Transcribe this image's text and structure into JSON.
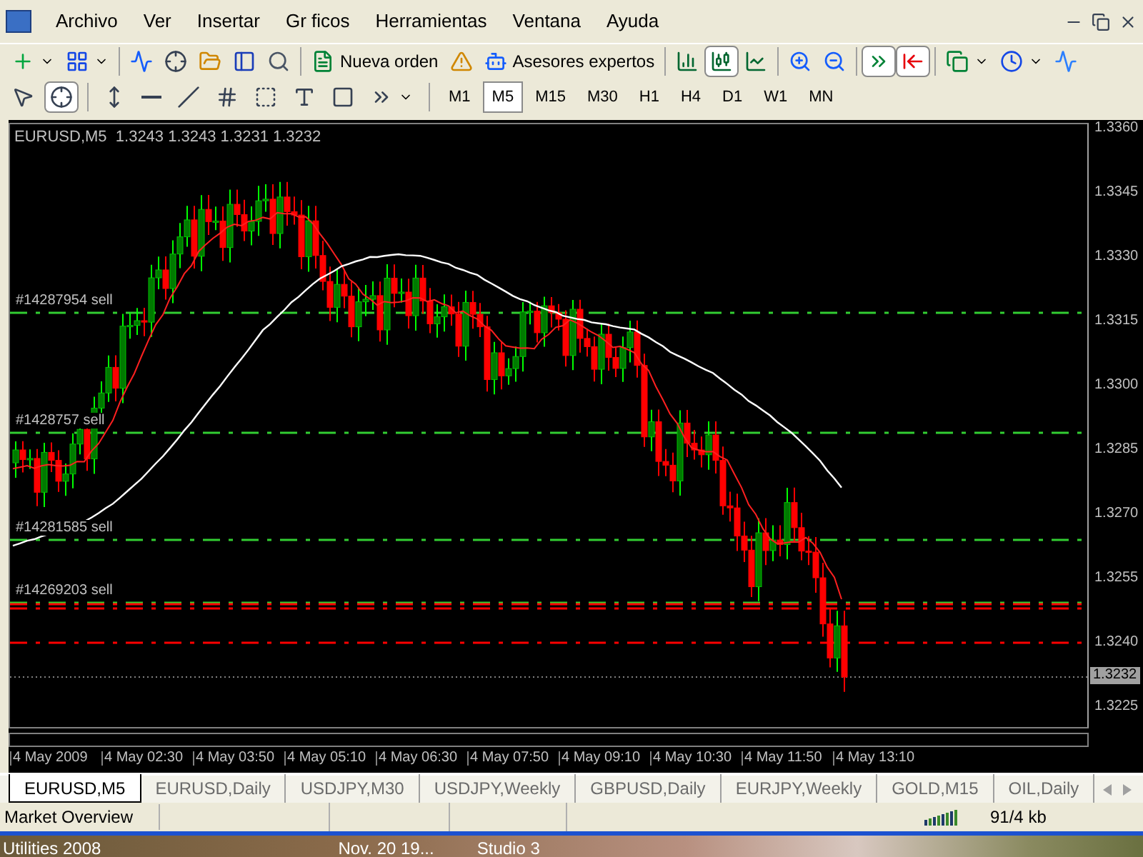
{
  "menu": {
    "items": [
      "Archivo",
      "Ver",
      "Insertar",
      "Gr ficos",
      "Herramientas",
      "Ventana",
      "Ayuda"
    ]
  },
  "toolbar_1": [
    {
      "kind": "dropdown",
      "pressed": false
    },
    {
      "kind": "dropdown",
      "pressed": false
    },
    {
      "kind": "separator"
    },
    {
      "kind": "icon",
      "pressed": false
    },
    {
      "kind": "icon",
      "pressed": false
    },
    {
      "kind": "icon",
      "pressed": false
    },
    {
      "kind": "icon",
      "pressed": false
    },
    {
      "kind": "icon",
      "pressed": false
    },
    {
      "kind": "separator"
    },
    {
      "kind": "labeled",
      "label": "Nueva orden",
      "pressed": false
    },
    {
      "kind": "icon",
      "pressed": false
    },
    {
      "kind": "labeled",
      "label": "Asesores expertos",
      "pressed": false
    },
    {
      "kind": "separator"
    },
    {
      "kind": "icon",
      "pressed": false
    },
    {
      "kind": "icon",
      "pressed": true
    },
    {
      "kind": "icon",
      "pressed": false
    },
    {
      "kind": "separator"
    },
    {
      "kind": "icon",
      "pressed": false
    },
    {
      "kind": "icon",
      "pressed": false
    },
    {
      "kind": "separator"
    },
    {
      "kind": "icon",
      "pressed": true
    },
    {
      "kind": "icon",
      "pressed": true
    },
    {
      "kind": "separator"
    },
    {
      "kind": "dropdown",
      "pressed": false
    },
    {
      "kind": "dropdown",
      "pressed": false
    },
    {
      "kind": "icon",
      "pressed": false
    }
  ],
  "toolbar_2": [
    {
      "kind": "icon",
      "pressed": false
    },
    {
      "kind": "icon",
      "pressed": true
    },
    {
      "kind": "separator"
    },
    {
      "kind": "icon",
      "pressed": false
    },
    {
      "kind": "icon",
      "pressed": false
    },
    {
      "kind": "icon",
      "pressed": false
    },
    {
      "kind": "icon",
      "pressed": false
    },
    {
      "kind": "icon",
      "pressed": false
    },
    {
      "kind": "icon",
      "pressed": false
    },
    {
      "kind": "icon",
      "pressed": false
    },
    {
      "kind": "dropdown",
      "pressed": false
    }
  ],
  "periods": [
    {
      "label": "M1",
      "selected": false
    },
    {
      "label": "M5",
      "selected": true
    },
    {
      "label": "M15",
      "selected": false
    },
    {
      "label": "M30",
      "selected": false
    },
    {
      "label": "H1",
      "selected": false
    },
    {
      "label": "H4",
      "selected": false
    },
    {
      "label": "D1",
      "selected": false
    },
    {
      "label": "W1",
      "selected": false
    },
    {
      "label": "MN",
      "selected": false
    }
  ],
  "chart": {
    "header": "EURUSD,M5  1.3243 1.3243 1.3231 1.3232",
    "order_lines": [
      {
        "label": "#14287954",
        "side": "sell",
        "color": "#32cd32"
      },
      {
        "label": "#1428757",
        "side": "sell",
        "color": "#32cd32"
      },
      {
        "label": "#14281585",
        "side": "sell",
        "color": "#32cd32"
      },
      {
        "label": "#14269203",
        "side": "sell",
        "color": "#32cd32"
      },
      {
        "color": "#ff0000"
      },
      {
        "color": "#ff0000"
      },
      {
        "color": "#ff0000"
      }
    ],
    "price_labels": [
      "1.3360",
      "1.3345",
      "1.3330",
      "1.3315",
      "1.3300",
      "1.3285",
      "1.3270",
      "1.3255",
      "1.3240",
      "1.3225"
    ],
    "current_price": "1.3232",
    "time_labels": [
      "4 May 2009",
      "4 May 02:30",
      "4 May 03:50",
      "4 May 05:10",
      "4 May 06:30",
      "4 May 07:50",
      "4 May 09:10",
      "4 May 10:30",
      "4 May 11:50",
      "4 May 13:10"
    ]
  },
  "chart_tabs": [
    {
      "label": "EURUSD,M5",
      "selected": true
    },
    {
      "label": "EURUSD,Daily",
      "selected": false
    },
    {
      "label": "USDJPY,M30",
      "selected": false
    },
    {
      "label": "USDJPY,Weekly",
      "selected": false
    },
    {
      "label": "GBPUSD,Daily",
      "selected": false
    },
    {
      "label": "EURJPY,Weekly",
      "selected": false
    },
    {
      "label": "GOLD,M15",
      "selected": false
    },
    {
      "label": "OIL,Daily",
      "selected": false
    }
  ],
  "status_bar": {
    "hint": "Market Overview",
    "traffic": "91/4 kb"
  },
  "taskbar": {
    "items": [
      "Utilities 2008",
      "Nov. 20 19...",
      "Studio 3"
    ]
  }
}
